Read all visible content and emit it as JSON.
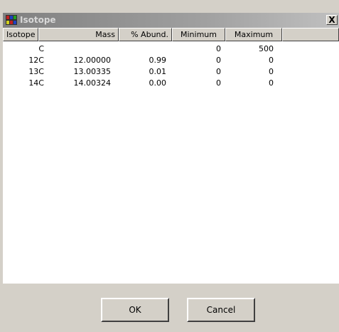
{
  "window": {
    "title": "Isotope",
    "close_label": "X"
  },
  "table": {
    "columns": [
      "Isotope",
      "Mass",
      "% Abund.",
      "Minimum",
      "Maximum"
    ],
    "rows": [
      [
        "C",
        "",
        "",
        "0",
        "500"
      ],
      [
        "12C",
        "12.00000",
        "0.99",
        "0",
        "0"
      ],
      [
        "13C",
        "13.00335",
        "0.01",
        "0",
        "0"
      ],
      [
        "14C",
        "14.00324",
        "0.00",
        "0",
        "0"
      ]
    ]
  },
  "buttons": {
    "ok": "OK",
    "cancel": "Cancel"
  }
}
